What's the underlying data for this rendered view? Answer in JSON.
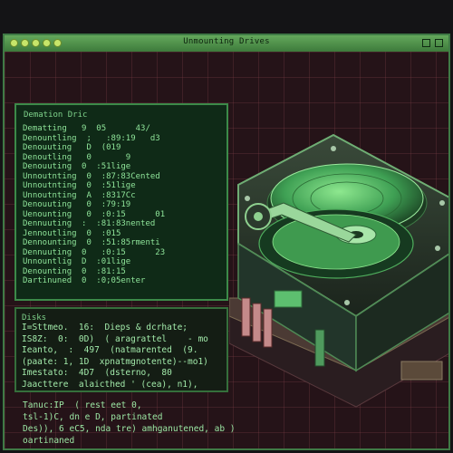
{
  "window": {
    "title": "Unmounting Drives",
    "dot_color": "#c7e66a",
    "accent": "#3c8a49"
  },
  "terminal": {
    "header": "Demation Dric",
    "lines": [
      "Dematting   9  05      43/",
      "Denountling  ;   :89:19   d3",
      "Denouuting   D  (019",
      "Denoutling   0       9",
      "Denouuting  0  :51lige",
      "Unnoutnting  0  :87:83Cented",
      "Unnoutnting  0  :51lige",
      "Unnoutnting  A  :8317Cc",
      "Denouuting   0  :79:19",
      "Uenounting   0  :0:15      01",
      "Dennuuting  :  :81:83nented",
      "Jennoutling  0  :015",
      "Dennounting  0  :51:85rmenti",
      "Dennuuting  0   :0:15      23",
      "Unnountlig  D  :01lige",
      "Denounting  0  :81:15",
      "Dartinuned  0  :0;05enter"
    ]
  },
  "disks": {
    "header": "Disks",
    "lines": [
      "I=Sttmeo.  16:  Dieps & dcrhate;",
      "IS8Z:  0:  0D)  ( aragrattel    - mo",
      "Ieanto,  :  497  (natmarented  (9.",
      "(paate: 1, 1D  xpnatmgnotente)--mo1)",
      "Imestato:  4D7  (dsterno,  80",
      "Jaacttere  alaicthed ' (cea), n1),"
    ]
  },
  "bottom": {
    "lines": [
      "Tanuc:IP  ( rest eet 0,",
      "tsl-1)C, dn e D, partinated",
      "Des)), 6 eC5, nda tre) amhganutened, ab )",
      "oartinaned"
    ]
  },
  "drive": {
    "platter_color": "#5dbf6f",
    "body_color": "#2a3a2c",
    "accent": "#3f9a4f"
  }
}
